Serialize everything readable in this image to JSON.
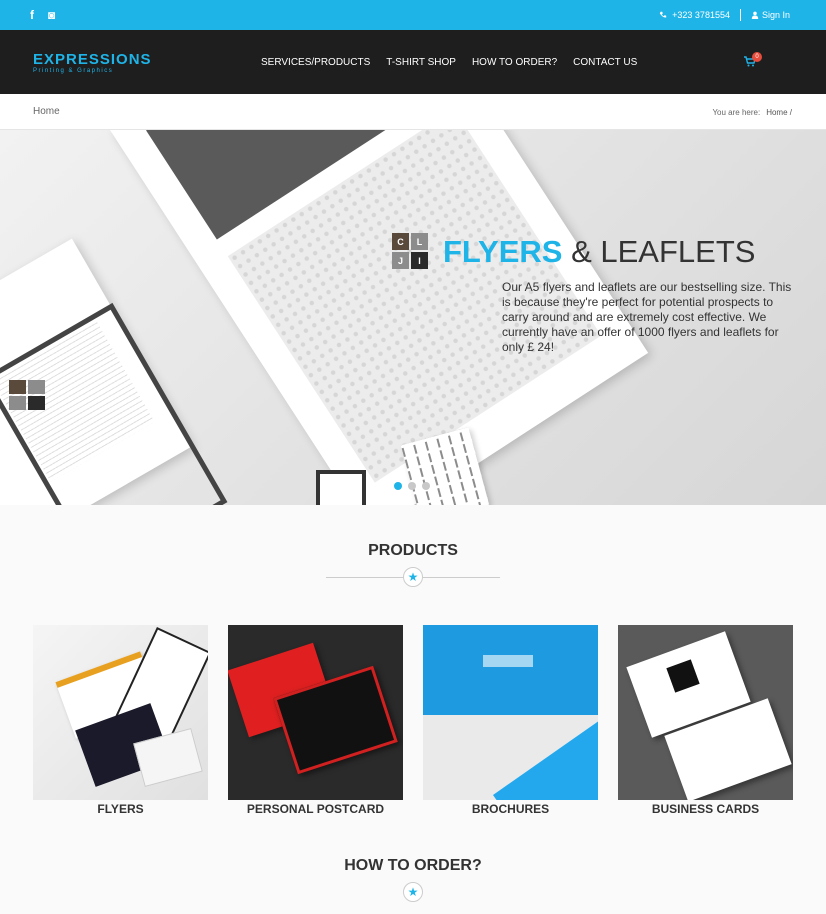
{
  "topbar": {
    "social": [
      "f",
      "◙"
    ],
    "phone": "+323 3781554",
    "signin": "Sign In"
  },
  "header": {
    "logo_name": "EXPRESSIONS",
    "logo_tag": "Printing & Graphics",
    "nav": [
      "SERVICES/PRODUCTS",
      "T-SHIRT SHOP",
      "HOW TO ORDER?",
      "CONTACT US"
    ],
    "cart_count": "0"
  },
  "breadcrumb": {
    "page": "Home",
    "you_are_here": "You are here:",
    "home": "Home /"
  },
  "hero": {
    "title_accent": "FLYERS",
    "title_rest": "& LEAFLETS",
    "text": "Our A5 flyers and leaflets are our bestselling size. This is because they're perfect for potential prospects to carry around and are extremely cost effective. We currently have an offer of 1000 flyers and leaflets for only £ 24!",
    "logo_letters": [
      "C",
      "L",
      "J",
      "I"
    ]
  },
  "products_section": {
    "title": "PRODUCTS",
    "items": [
      {
        "label": "FLYERS"
      },
      {
        "label": "PERSONAL POSTCARD"
      },
      {
        "label": "BROCHURES"
      },
      {
        "label": "BUSINESS CARDS"
      }
    ]
  },
  "order_section": {
    "title": "HOW TO ORDER?"
  },
  "colors": {
    "accent": "#1fb4e8",
    "header": "#1e1e1e"
  }
}
